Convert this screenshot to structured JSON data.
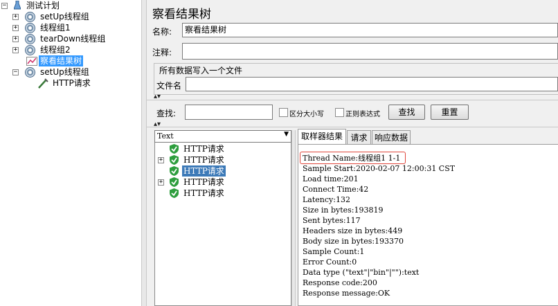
{
  "tree": {
    "root": "测试计划",
    "items": [
      {
        "label": "setUp线程组",
        "kind": "thread-group",
        "expander": "+"
      },
      {
        "label": "线程组1",
        "kind": "thread-group",
        "expander": "+"
      },
      {
        "label": "tearDown线程组",
        "kind": "thread-group",
        "expander": "+"
      },
      {
        "label": "线程组2",
        "kind": "thread-group",
        "expander": "+"
      },
      {
        "label": "察看结果树",
        "kind": "listener",
        "selected": true
      },
      {
        "label": "setUp线程组",
        "kind": "thread-group",
        "expander": "−"
      },
      {
        "label": "HTTP请求",
        "kind": "sampler"
      }
    ]
  },
  "panel": {
    "title": "察看结果树",
    "name_label": "名称:",
    "name_value": "察看结果树",
    "comment_label": "注释:",
    "comment_value": "",
    "file_section_title": "所有数据写入一个文件",
    "filename_label": "文件名",
    "filename_value": ""
  },
  "search": {
    "label": "查找:",
    "value": "",
    "case_label": "区分大小写",
    "regex_label": "正则表达式",
    "find_button": "查找",
    "reset_button": "重置"
  },
  "results": {
    "renderer": "Text",
    "items": [
      {
        "label": "HTTP请求",
        "expander": ""
      },
      {
        "label": "HTTP请求",
        "expander": "+"
      },
      {
        "label": "HTTP请求",
        "expander": "",
        "selected": true
      },
      {
        "label": "HTTP请求",
        "expander": "+"
      },
      {
        "label": "HTTP请求",
        "expander": ""
      }
    ],
    "tabs": [
      "取样器结果",
      "请求",
      "响应数据"
    ],
    "active_tab": "取样器结果",
    "sampler_lines": [
      "Thread Name:线程组1 1-1",
      "Sample Start:2020-02-07 12:00:31 CST",
      "Load time:201",
      "Connect Time:42",
      "Latency:132",
      "Size in bytes:193819",
      "Sent bytes:117",
      "Headers size in bytes:449",
      "Body size in bytes:193370",
      "Sample Count:1",
      "Error Count:0",
      "Data type (\"text\"|\"bin\"|\"\"):text",
      "Response code:200",
      "Response message:OK"
    ]
  },
  "colors": {
    "selection": "#3399ff",
    "highlight_border": "#e0453a",
    "success_shield": "#2e9e3e"
  }
}
